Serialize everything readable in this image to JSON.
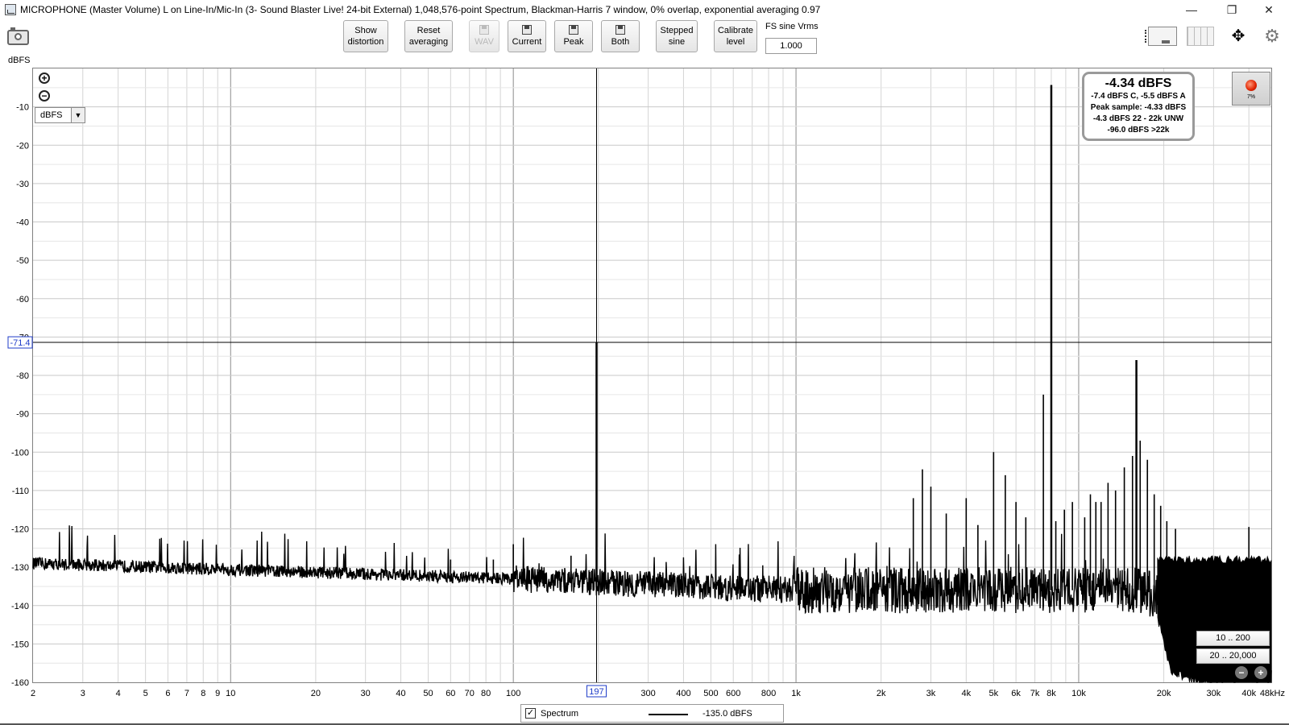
{
  "window": {
    "title": "MICROPHONE (Master Volume) L on Line-In/Mic-In (3- Sound Blaster Live! 24-bit External) 1,048,576-point Spectrum, Blackman-Harris 7 window, 0% overlap, exponential averaging 0.97",
    "minimize": "—",
    "restore": "❐",
    "close": "✕"
  },
  "toolbar": {
    "show_distortion_1": "Show",
    "show_distortion_2": "distortion",
    "reset_averaging_1": "Reset",
    "reset_averaging_2": "averaging",
    "wav_label": "WAV",
    "current_label": "Current",
    "peak_label": "Peak",
    "both_label": "Both",
    "stepped_sine_1": "Stepped",
    "stepped_sine_2": "sine",
    "calibrate_1": "Calibrate",
    "calibrate_2": "level",
    "fs_label": "FS sine Vrms",
    "fs_value": "1.000",
    "fit_glyph": "✥",
    "gear_glyph": "⚙"
  },
  "plot": {
    "unit_label": "dBFS",
    "units_select_value": "dBFS",
    "zoom_in_glyph": "+",
    "zoom_out_glyph": "−"
  },
  "readout": {
    "main": "-4.34 dBFS",
    "line1": "-7.4 dBFS C, -5.5 dBFS A",
    "line2": "Peak sample: -4.33 dBFS",
    "line3": "-4.3 dBFS 22 - 22k UNW",
    "line4": "-96.0 dBFS >22k"
  },
  "record": {
    "percent": "7%"
  },
  "range_buttons": {
    "r1": "10 .. 200",
    "r2": "20 .. 20,000"
  },
  "legend": {
    "checkbox": "✓",
    "name": "Spectrum",
    "value": "-135.0 dBFS"
  },
  "chart_data": {
    "type": "line",
    "x_scale": "log",
    "x_range": [
      2,
      48000
    ],
    "y_range": [
      -160,
      0
    ],
    "y_ticks": [
      -10,
      -20,
      -30,
      -40,
      -50,
      -60,
      -70,
      -80,
      -90,
      -100,
      -110,
      -120,
      -130,
      -140,
      -150,
      -160
    ],
    "y_tick_labels": [
      "-10",
      "-20",
      "-30",
      "-40",
      "-50",
      "-60",
      "-70",
      "-80",
      "-90",
      "-100",
      "-110",
      "-120",
      "-130",
      "-140",
      "-150",
      "-160"
    ],
    "x_ticks": [
      {
        "f": 2,
        "label": "2"
      },
      {
        "f": 3,
        "label": "3"
      },
      {
        "f": 4,
        "label": "4"
      },
      {
        "f": 5,
        "label": "5"
      },
      {
        "f": 6,
        "label": "6"
      },
      {
        "f": 7,
        "label": "7"
      },
      {
        "f": 8,
        "label": "8"
      },
      {
        "f": 9,
        "label": "9"
      },
      {
        "f": 10,
        "label": "10"
      },
      {
        "f": 20,
        "label": "20"
      },
      {
        "f": 30,
        "label": "30"
      },
      {
        "f": 40,
        "label": "40"
      },
      {
        "f": 50,
        "label": "50"
      },
      {
        "f": 60,
        "label": "60"
      },
      {
        "f": 70,
        "label": "70"
      },
      {
        "f": 80,
        "label": "80"
      },
      {
        "f": 100,
        "label": "100"
      },
      {
        "f": 300,
        "label": "300"
      },
      {
        "f": 400,
        "label": "400"
      },
      {
        "f": 500,
        "label": "500"
      },
      {
        "f": 600,
        "label": "600"
      },
      {
        "f": 800,
        "label": "800"
      },
      {
        "f": 1000,
        "label": "1k"
      },
      {
        "f": 2000,
        "label": "2k"
      },
      {
        "f": 3000,
        "label": "3k"
      },
      {
        "f": 4000,
        "label": "4k"
      },
      {
        "f": 5000,
        "label": "5k"
      },
      {
        "f": 6000,
        "label": "6k"
      },
      {
        "f": 7000,
        "label": "7k"
      },
      {
        "f": 8000,
        "label": "8k"
      },
      {
        "f": 10000,
        "label": "10k"
      },
      {
        "f": 20000,
        "label": "20k"
      },
      {
        "f": 30000,
        "label": "30k"
      },
      {
        "f": 40000,
        "label": "40k"
      },
      {
        "f": 48000,
        "label": "48kHz"
      }
    ],
    "cursor": {
      "frequency": 197,
      "frequency_label": "197",
      "level": -71.4,
      "level_label": "-71.4"
    },
    "grid": true,
    "series": [
      {
        "name": "Spectrum",
        "color": "#000000",
        "noise_floor": [
          [
            2,
            -129
          ],
          [
            100,
            -133
          ],
          [
            1000,
            -136
          ],
          [
            10000,
            -136
          ],
          [
            17000,
            -136
          ],
          [
            19000,
            -138
          ],
          [
            21000,
            -152
          ],
          [
            30000,
            -157
          ],
          [
            48000,
            -157
          ]
        ],
        "peaks": [
          [
            197,
            -71.4
          ],
          [
            8000,
            -4.3
          ],
          [
            7500,
            -85
          ],
          [
            16000,
            -76
          ],
          [
            8300,
            -118
          ],
          [
            5000,
            -100
          ],
          [
            14500,
            -104
          ],
          [
            15500,
            -101
          ],
          [
            16500,
            -97
          ],
          [
            17500,
            -102
          ],
          [
            12000,
            -113
          ],
          [
            12700,
            -108
          ],
          [
            13500,
            -110
          ],
          [
            3000,
            -109
          ],
          [
            2600,
            -112
          ],
          [
            2800,
            -104.5
          ],
          [
            3400,
            -116
          ],
          [
            4000,
            -112
          ],
          [
            4400,
            -119
          ],
          [
            5500,
            -106
          ],
          [
            6000,
            -113
          ],
          [
            6500,
            -117
          ],
          [
            8900,
            -115
          ],
          [
            9500,
            -113
          ],
          [
            10500,
            -117
          ],
          [
            11000,
            -111
          ],
          [
            11500,
            -113
          ],
          [
            18500,
            -111
          ],
          [
            19500,
            -114
          ],
          [
            20500,
            -118
          ],
          [
            22000,
            -120
          ],
          [
            40000,
            -119.5
          ],
          [
            100,
            -124
          ],
          [
            60,
            -128
          ],
          [
            85,
            -128
          ],
          [
            160,
            -127
          ]
        ]
      }
    ]
  }
}
